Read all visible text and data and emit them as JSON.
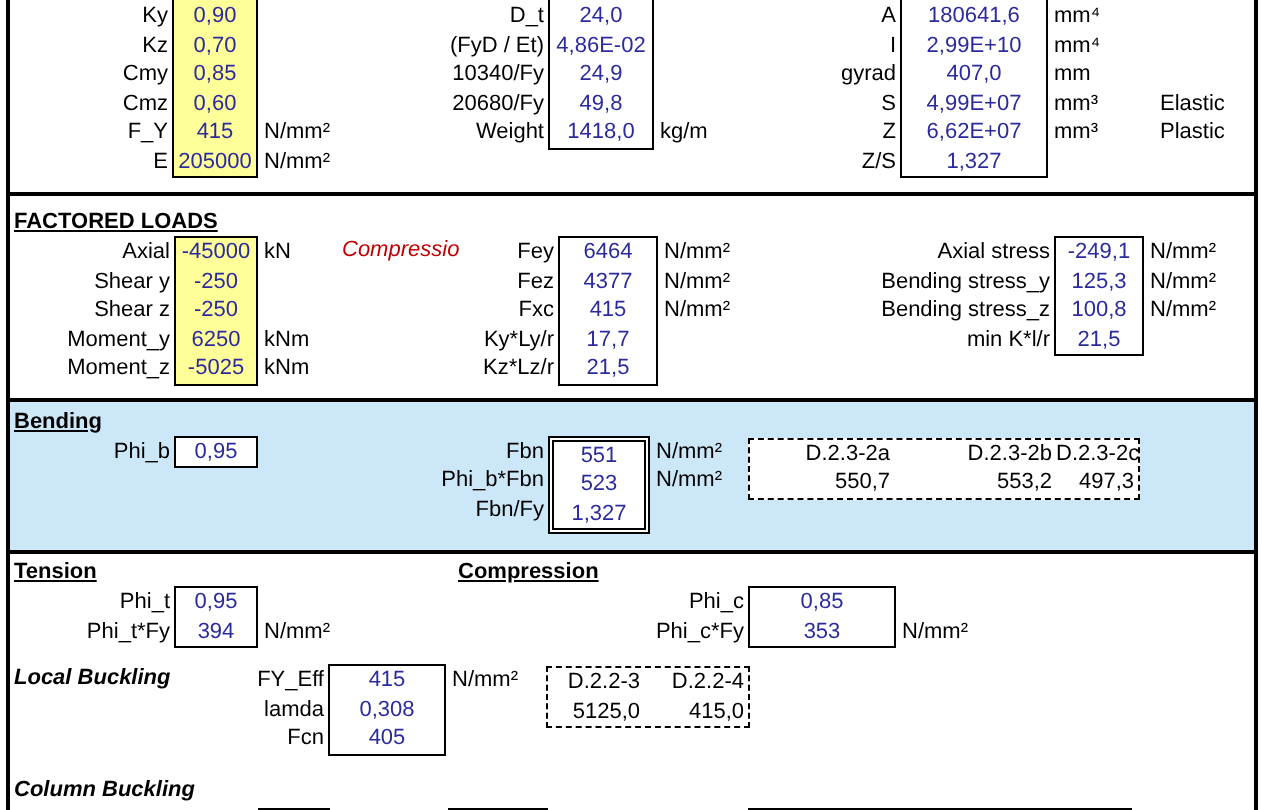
{
  "properties": {
    "left": [
      {
        "label": "Ky",
        "value": "0,90"
      },
      {
        "label": "Kz",
        "value": "0,70"
      },
      {
        "label": "Cmy",
        "value": "0,85"
      },
      {
        "label": "Cmz",
        "value": "0,60"
      },
      {
        "label": "F_Y",
        "value": "415",
        "unit": "N/mm²"
      },
      {
        "label": "E",
        "value": "205000",
        "unit": "N/mm²"
      }
    ],
    "middle": [
      {
        "label": "D_t",
        "value": "24,0"
      },
      {
        "label": "(FyD / Et)",
        "value": "4,86E-02"
      },
      {
        "label": "10340/Fy",
        "value": "24,9"
      },
      {
        "label": "20680/Fy",
        "value": "49,8"
      },
      {
        "label": "Weight",
        "value": "1418,0",
        "unit": "kg/m"
      }
    ],
    "right": [
      {
        "label": "A",
        "value": "180641,6",
        "unit": "mm⁴"
      },
      {
        "label": "I",
        "value": "2,99E+10",
        "unit": "mm⁴"
      },
      {
        "label": "gyrad",
        "value": "407,0",
        "unit": "mm"
      },
      {
        "label": "S",
        "value": "4,99E+07",
        "unit": "mm³",
        "note": "Elastic"
      },
      {
        "label": "Z",
        "value": "6,62E+07",
        "unit": "mm³",
        "note": "Plastic"
      },
      {
        "label": "Z/S",
        "value": "1,327"
      }
    ]
  },
  "factored_loads": {
    "title": "FACTORED LOADS",
    "note": "Compressio",
    "left": [
      {
        "label": "Axial",
        "value": "-45000",
        "unit": "kN"
      },
      {
        "label": "Shear y",
        "value": "-250"
      },
      {
        "label": "Shear z",
        "value": "-250"
      },
      {
        "label": "Moment_y",
        "value": "6250",
        "unit": "kNm"
      },
      {
        "label": "Moment_z",
        "value": "-5025",
        "unit": "kNm"
      }
    ],
    "middle": [
      {
        "label": "Fey",
        "value": "6464",
        "unit": "N/mm²"
      },
      {
        "label": "Fez",
        "value": "4377",
        "unit": "N/mm²"
      },
      {
        "label": "Fxc",
        "value": "415",
        "unit": "N/mm²"
      },
      {
        "label": "Ky*Ly/r",
        "value": "17,7"
      },
      {
        "label": "Kz*Lz/r",
        "value": "21,5"
      }
    ],
    "right": [
      {
        "label": "Axial stress",
        "value": "-249,1",
        "unit": "N/mm²"
      },
      {
        "label": "Bending stress_y",
        "value": "125,3",
        "unit": "N/mm²"
      },
      {
        "label": "Bending stress_z",
        "value": "100,8",
        "unit": "N/mm²"
      },
      {
        "label": "min K*l/r",
        "value": "21,5"
      }
    ]
  },
  "bending": {
    "title": "Bending",
    "inputs": [
      {
        "label": "Phi_b",
        "value": "0,95"
      }
    ],
    "results": [
      {
        "label": "Fbn",
        "value": "551",
        "unit": "N/mm²"
      },
      {
        "label": "Phi_b*Fbn",
        "value": "523",
        "unit": "N/mm²"
      },
      {
        "label": "Fbn/Fy",
        "value": "1,327"
      }
    ],
    "checks": [
      {
        "clause": "D.2.3-2a",
        "value": "550,7"
      },
      {
        "clause": "D.2.3-2b",
        "value": "553,2"
      },
      {
        "clause": "D.2.3-2c",
        "value": "497,3"
      }
    ]
  },
  "tension": {
    "title": "Tension",
    "rows": [
      {
        "label": "Phi_t",
        "value": "0,95"
      },
      {
        "label": "Phi_t*Fy",
        "value": "394",
        "unit": "N/mm²"
      }
    ]
  },
  "compression": {
    "title": "Compression",
    "rows": [
      {
        "label": "Phi_c",
        "value": "0,85"
      },
      {
        "label": "Phi_c*Fy",
        "value": "353",
        "unit": "N/mm²"
      }
    ]
  },
  "local_buckling": {
    "title": "Local Buckling",
    "rows": [
      {
        "label": "FY_Eff",
        "value": "415",
        "unit": "N/mm²"
      },
      {
        "label": "lamda",
        "value": "0,308"
      },
      {
        "label": "Fcn",
        "value": "405"
      }
    ],
    "checks": [
      {
        "clause": "D.2.2-3",
        "value": "5125,0"
      },
      {
        "clause": "D.2.2-4",
        "value": "415,0"
      }
    ]
  },
  "column_buckling": {
    "title": "Column Buckling"
  }
}
